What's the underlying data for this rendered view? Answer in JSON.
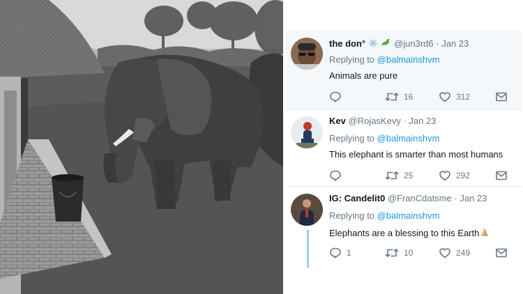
{
  "tweets": [
    {
      "name": "the don°",
      "handle": "@jun3rd6",
      "separator": "·",
      "date": "Jan 23",
      "reply_prefix": "Replying to",
      "reply_to": "@balmainshvm",
      "text": "Animals are pure",
      "reply_count": "",
      "retweet_count": "16",
      "like_count": "312",
      "name_emojis": [
        "snowflake-emoji",
        "dragon-emoji"
      ]
    },
    {
      "name": "Kev",
      "handle": "@RojasKevy",
      "separator": "·",
      "date": "Jan 23",
      "reply_prefix": "Replying to",
      "reply_to": "@balmainshvm",
      "text": "This elephant is smarter than most humans",
      "reply_count": "",
      "retweet_count": "25",
      "like_count": "292"
    },
    {
      "name": "IG: Candelit0",
      "handle": "@FranCdatsme",
      "separator": "·",
      "date": "Jan 23",
      "reply_prefix": "Replying to",
      "reply_to": "@balmainshvm",
      "text": "Elephants are a blessing to this Earth",
      "text_emoji": "folded-hands-emoji",
      "reply_count": "1",
      "retweet_count": "10",
      "like_count": "249"
    }
  ],
  "colors": {
    "accent": "#1b95e0",
    "muted": "#657786",
    "highlight_bg": "#f5f8fa",
    "thread_line": "#9dd1f2"
  },
  "icons": {
    "reply": "reply-icon",
    "retweet": "retweet-icon",
    "like": "heart-icon",
    "dm": "envelope-icon"
  },
  "photo": {
    "description_icon": "elephant-photo"
  }
}
